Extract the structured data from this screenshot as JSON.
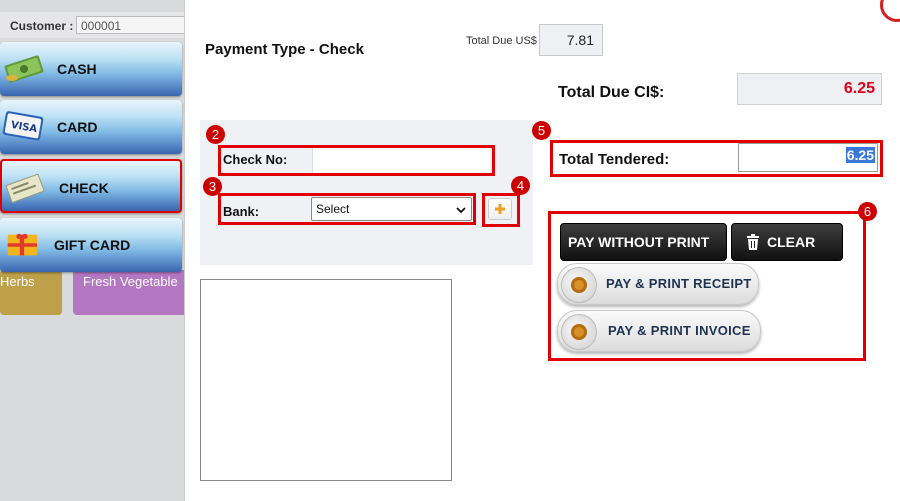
{
  "background": {
    "customer_label": "Customer :",
    "customer_value": "000001",
    "tiles": [
      "Herbs",
      "Fresh Vegetable"
    ]
  },
  "payment_methods": [
    {
      "label": "CASH",
      "icon": "cash-icon"
    },
    {
      "label": "CARD",
      "icon": "credit-card-icon"
    },
    {
      "label": "CHECK",
      "icon": "check-icon"
    },
    {
      "label": "GIFT CARD",
      "icon": "gift-card-icon"
    }
  ],
  "modal": {
    "title": "Payment Type - Check",
    "total_due_usd_label": "Total Due US$",
    "total_due_usd_value": "7.81",
    "total_due_ci_label": "Total Due CI$:",
    "total_due_ci_value": "6.25",
    "total_tendered_label": "Total Tendered:",
    "total_tendered_value": "6.25",
    "check_no_label": "Check No:",
    "check_no_value": "",
    "bank_label": "Bank:",
    "bank_selected": "Select",
    "buttons": {
      "pay_without_print": "PAY WITHOUT PRINT",
      "clear": "CLEAR",
      "pay_print_receipt": "PAY & PRINT RECEIPT",
      "pay_print_invoice": "PAY & PRINT INVOICE"
    }
  },
  "annotations": [
    "2",
    "3",
    "4",
    "5",
    "6"
  ],
  "colors": {
    "highlight_red": "#e00000",
    "due_red": "#e0001b",
    "selection_blue": "#3a78d8"
  }
}
